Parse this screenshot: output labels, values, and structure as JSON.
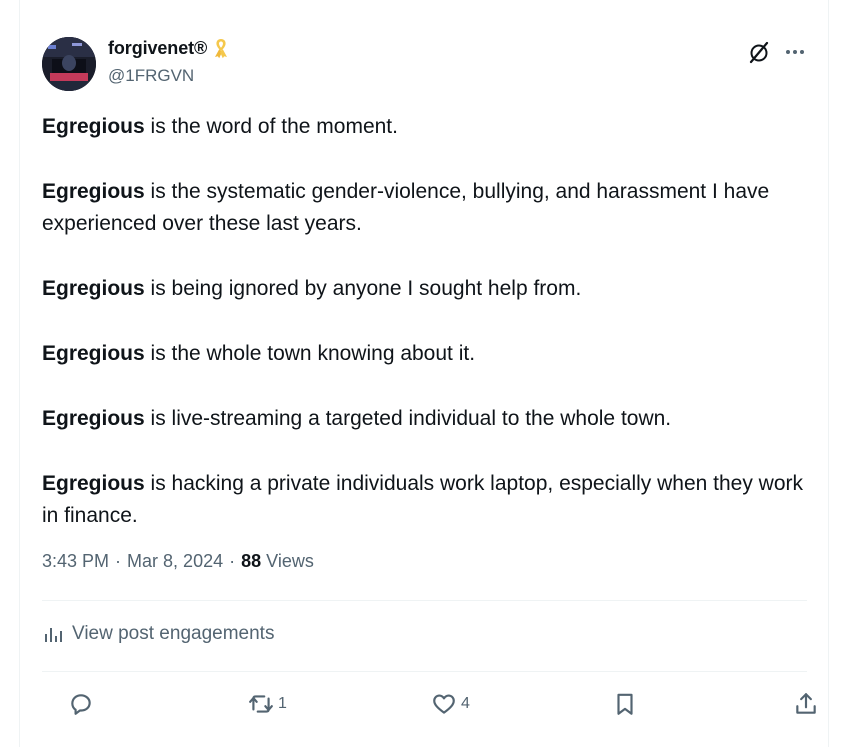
{
  "user": {
    "display_name": "forgivenet®",
    "handle": "@1FRGVN"
  },
  "tweet": {
    "paragraphs": [
      {
        "bold": "Egregious",
        "rest": " is the word of the moment."
      },
      {
        "bold": "Egregious",
        "rest": " is the systematic gender-violence, bullying, and harassment I have experienced over these last years."
      },
      {
        "bold": "Egregious",
        "rest": " is being ignored by anyone I sought help from."
      },
      {
        "bold": "Egregious",
        "rest": " is the whole town knowing about it."
      },
      {
        "bold": "Egregious",
        "rest": " is live-streaming a targeted individual to the whole town."
      },
      {
        "bold": "Egregious",
        "rest": " is hacking a private individuals work laptop, especially when they work in finance."
      }
    ]
  },
  "meta": {
    "time": "3:43 PM",
    "separator": "·",
    "date": "Mar 8, 2024",
    "views_count": "88",
    "views_label": "Views"
  },
  "engagements": {
    "label": "View post engagements"
  },
  "actions": {
    "reply_count": "",
    "repost_count": "1",
    "like_count": "4"
  },
  "icons": {
    "badge": "yellow-ribbon-icon",
    "top_right": [
      "grok-slash-icon",
      "more-icon"
    ],
    "actions": [
      "reply-icon",
      "repost-icon",
      "like-icon",
      "bookmark-icon",
      "share-icon"
    ]
  },
  "colors": {
    "text": "#0f1419",
    "secondary": "#536471",
    "divider": "#eff3f4",
    "ribbon": "#f5c84c"
  }
}
